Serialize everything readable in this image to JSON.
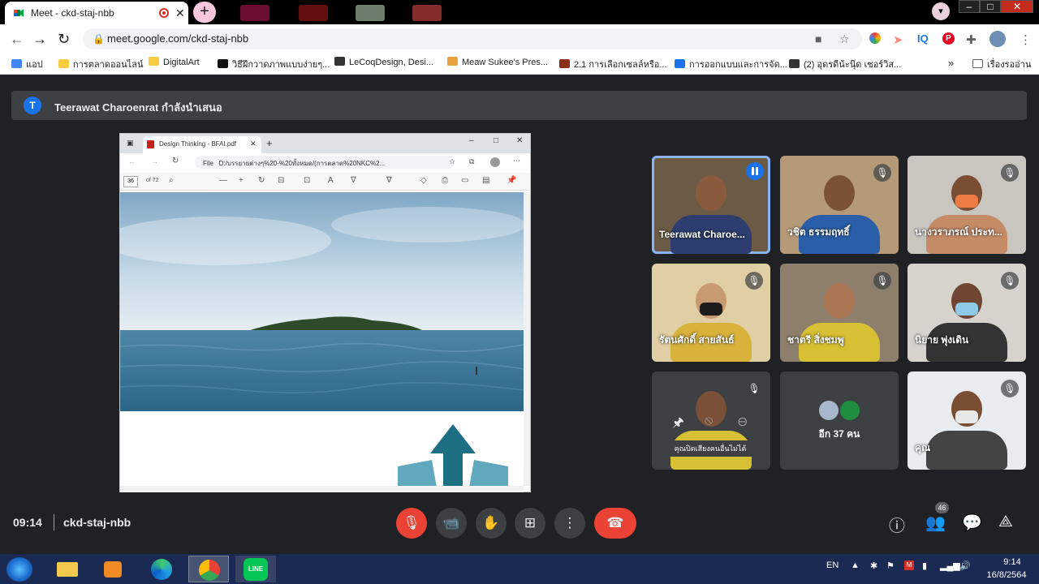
{
  "browser": {
    "tab_title": "Meet - ckd-staj-nbb",
    "tab_close": "✕",
    "new_tab": "+",
    "url": "meet.google.com/ckd-staj-nbb",
    "bookmarks": [
      {
        "label": "แอป",
        "color": "#4285f4"
      },
      {
        "label": "การตลาดออนไลน์",
        "color": "#f9cb40"
      },
      {
        "label": "DigitalArt",
        "color": "#f9cb40"
      },
      {
        "label": "วิธีฝึกวาดภาพแบบง่ายๆ...",
        "color": "#111111"
      },
      {
        "label": "LeCoqDesign, Desi...",
        "color": "#333333"
      },
      {
        "label": "Meaw Sukee's Pres...",
        "color": "#e8a33d"
      },
      {
        "label": "2.1 การเลือกเซลล์หรือ...",
        "color": "#8b2f1d"
      },
      {
        "label": "การออกแบบและการจัด...",
        "color": "#1a73e8"
      },
      {
        "label": "(2) อุดรดีน้ะนุ๊ด เซอร์วิส...",
        "color": "#333333"
      }
    ],
    "bookmarks_more": "»",
    "reading_list": "เรื่องรออ่าน"
  },
  "presenter": {
    "initial": "T",
    "text": "Teerawat Charoenrat กำลังนำเสนอ"
  },
  "shared_screen": {
    "tab_title": "Design Thinking - BFAI.pdf",
    "tab_close": "✕",
    "new_tab": "+",
    "file_label": "File",
    "path": "D:/บรรยายต่างๆ%20-%20ทั้งหมด/(การตลาด%20NKC%2...",
    "page_current": "36",
    "page_of": "of 72"
  },
  "participants": [
    {
      "name": "Teerawat Charoe...",
      "speaking": true,
      "bg": "#6b5a45",
      "skin": "#8a5a3c",
      "shirt": "#2d3e6e"
    },
    {
      "name": "วชิต ธรรมฤทธิ์",
      "speaking": false,
      "bg": "#b59a78",
      "skin": "#7c5236",
      "shirt": "#2a5ea8"
    },
    {
      "name": "นางวราภรณ์ ประท...",
      "speaking": false,
      "bg": "#c9c6c0",
      "skin": "#7a4e33",
      "shirt": "#c58b67",
      "mask": "#ee7b44"
    },
    {
      "name": "รัตนศักดิ์ สายสันธ์",
      "speaking": false,
      "bg": "#e0cfa4",
      "skin": "#c79a72",
      "shirt": "#d9b23c",
      "mask": "#1c1c1c"
    },
    {
      "name": "ชาตรี สิ่งชมพู",
      "speaking": false,
      "bg": "#8e7f6c",
      "skin": "#a97553",
      "shirt": "#d8c034"
    },
    {
      "name": "นิยาย พุ่งเดิน",
      "speaking": false,
      "bg": "#d5d3cc",
      "skin": "#6e4633",
      "shirt": "#333333",
      "mask": "#8ec9e8"
    },
    {
      "name": "",
      "speaking": false,
      "bg": "#3c4043",
      "skin": "#7a5038",
      "shirt": "#d8c034"
    },
    {
      "name": "อีก 37 คน",
      "speaking": false,
      "bg": "#3c4043"
    },
    {
      "name": "คุณ",
      "speaking": false,
      "bg": "#e8ecef",
      "skin": "#7a4e33",
      "shirt": "#444444",
      "mask": "#e8e8e8"
    }
  ],
  "tooltip": "คุณปิดเสียงคนอื่นไม่ได้",
  "meeting": {
    "time": "09:14",
    "code": "ckd-staj-nbb",
    "people_count": "46"
  },
  "taskbar": {
    "lang": "EN",
    "clock_time": "9:14",
    "clock_date": "16/8/2564"
  }
}
